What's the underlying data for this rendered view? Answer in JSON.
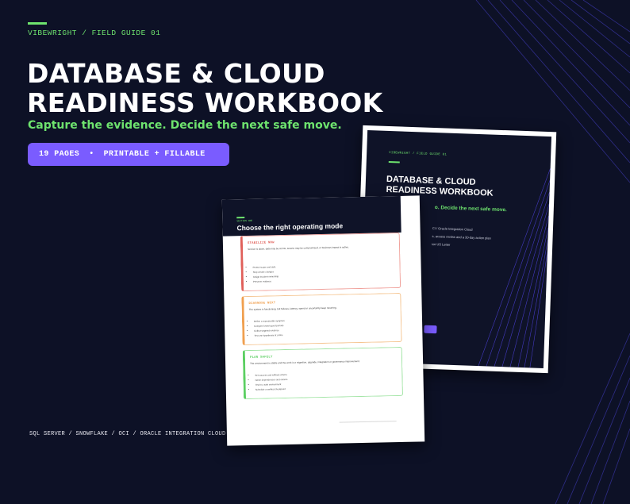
{
  "eyebrow": "VIBEWRIGHT / FIELD GUIDE 01",
  "title": {
    "line1": "DATABASE & CLOUD",
    "line2": "READINESS WORKBOOK"
  },
  "subtitle": "Capture the evidence. Decide the next safe move.",
  "badge": {
    "pages": "19 PAGES",
    "separator": "•",
    "formats": "PRINTABLE + FILLABLE"
  },
  "platforms": [
    "SQL SERVER",
    "SNOWFLAKE",
    "OCI",
    "ORACLE INTEGRATION CLOUD"
  ],
  "platforms_text": "SQL SERVER  /  SNOWFLAKE  /  OCI  /  ORACLE INTEGRATION CLOUD",
  "cover_preview": {
    "eyebrow": "VIBEWRIGHT / FIELD GUIDE 01",
    "title_line1": "DATABASE & CLOUD",
    "title_line2": "READINESS WORKBOOK",
    "subtitle_visible": "o. Decide the next safe move.",
    "platforms_fragment": "CI  /  Oracle Integration Cloud",
    "detail_fragment": "s, access review and a 30-day action plan",
    "size_fragment": "ize US Letter"
  },
  "inner_preview": {
    "section_label": "SECTION ONE",
    "heading": "Choose the right operating mode",
    "modes": [
      {
        "label": "STABILIZE NOW",
        "description": "Service is down, data may be at risk, access may be compromised, or business impact is active.",
        "bullets": [
          "Protect scope and data",
          "Stop unsafe changes",
          "Assign incident ownership",
          "Preserve evidence"
        ],
        "color": "#e0605a"
      },
      {
        "label": "DIAGNOSE NEXT",
        "description": "The system is functioning, but failures, latency, spend or uncertainty keep recurring.",
        "bullets": [
          "Define a reproducible symptom",
          "Compare known good periods",
          "Collect targeted evidence",
          "Test one hypothesis at a time"
        ],
        "color": "#f0a050"
      },
      {
        "label": "PLAN SAFELY",
        "description": "The environment is stable and the work is a migration, upgrade, integration or governance improvement.",
        "bullets": [
          "Set success and rollback criteria",
          "Name dependencies and owners",
          "Test in a safe environment",
          "Schedule a verified checkpoint"
        ],
        "color": "#5ccf62"
      }
    ]
  },
  "colors": {
    "background": "#0d1126",
    "accent_green": "#6ee36e",
    "accent_purple": "#7a5cff",
    "title_text": "#ffffff"
  }
}
